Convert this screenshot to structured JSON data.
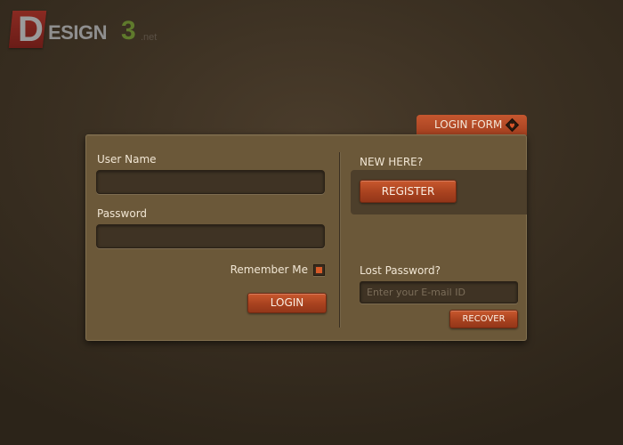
{
  "logo": {
    "letter": "D",
    "rest": "ESIGN",
    "number": "3",
    "tld": ".net"
  },
  "tab": {
    "label": "LOGIN FORM",
    "icon": "tag-heart-icon"
  },
  "login": {
    "username_label": "User Name",
    "username_value": "",
    "password_label": "Password",
    "password_value": "",
    "remember_label": "Remember Me",
    "remember_checked": true,
    "login_button": "LOGIN"
  },
  "register": {
    "heading": "NEW HERE?",
    "button": "REGISTER"
  },
  "recover": {
    "heading": "Lost Password?",
    "email_placeholder": "Enter your E-mail ID",
    "email_value": "",
    "button": "RECOVER"
  },
  "colors": {
    "accent": "#b34a24",
    "panel": "#6b5839",
    "background": "#3b3022",
    "checkbox_mark": "#d75a28"
  }
}
